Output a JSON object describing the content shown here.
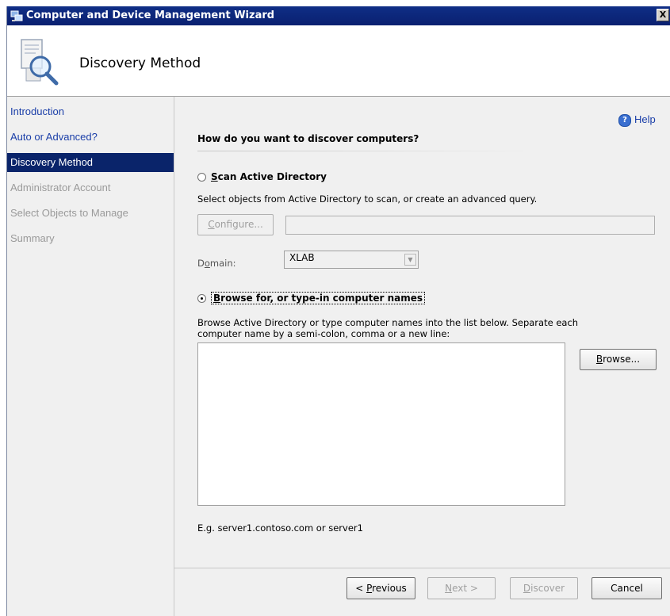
{
  "window": {
    "title": "Computer and Device Management Wizard",
    "close_label": "X"
  },
  "header": {
    "title": "Discovery Method",
    "icon": "magnifier-document-icon"
  },
  "sidebar": {
    "steps": [
      {
        "label": "Introduction",
        "state": "done"
      },
      {
        "label": "Auto or Advanced?",
        "state": "done"
      },
      {
        "label": "Discovery Method",
        "state": "current"
      },
      {
        "label": "Administrator Account",
        "state": "future"
      },
      {
        "label": "Select Objects to Manage",
        "state": "future"
      },
      {
        "label": "Summary",
        "state": "future"
      }
    ]
  },
  "content": {
    "help_label": "Help",
    "question": "How do you want to discover computers?",
    "scan_ad": {
      "label_first": "S",
      "label_rest": "can Active Directory",
      "checked": false,
      "description": "Select objects from Active Directory to scan, or create an advanced query.",
      "configure_first": "C",
      "configure_rest": "onfigure...",
      "configure_value": "",
      "domain_label_a": "D",
      "domain_label_b": "o",
      "domain_label_c": "main:",
      "domain_value": "XLAB"
    },
    "browse": {
      "label_first": "B",
      "label_rest": "rowse for, or type-in computer names",
      "checked": true,
      "description_line1": "Browse Active Directory or type computer names into the list below. Separate each",
      "description_line2": "computer name by a semi-colon, comma or a new line:",
      "names_value": "",
      "browse_button_first": "B",
      "browse_button_rest": "rowse...",
      "example": "E.g. server1.contoso.com or server1"
    }
  },
  "footer": {
    "previous_first": "< ",
    "previous_ul": "P",
    "previous_rest": "revious",
    "next_ul": "N",
    "next_rest": "ext >",
    "discover_ul": "D",
    "discover_rest": "iscover",
    "cancel_label": "Cancel"
  },
  "colors": {
    "title_bar": "#0a2070",
    "selected_step": "#0a246a",
    "link": "#1a3ea8",
    "disabled_text": "#a0a0a0"
  }
}
